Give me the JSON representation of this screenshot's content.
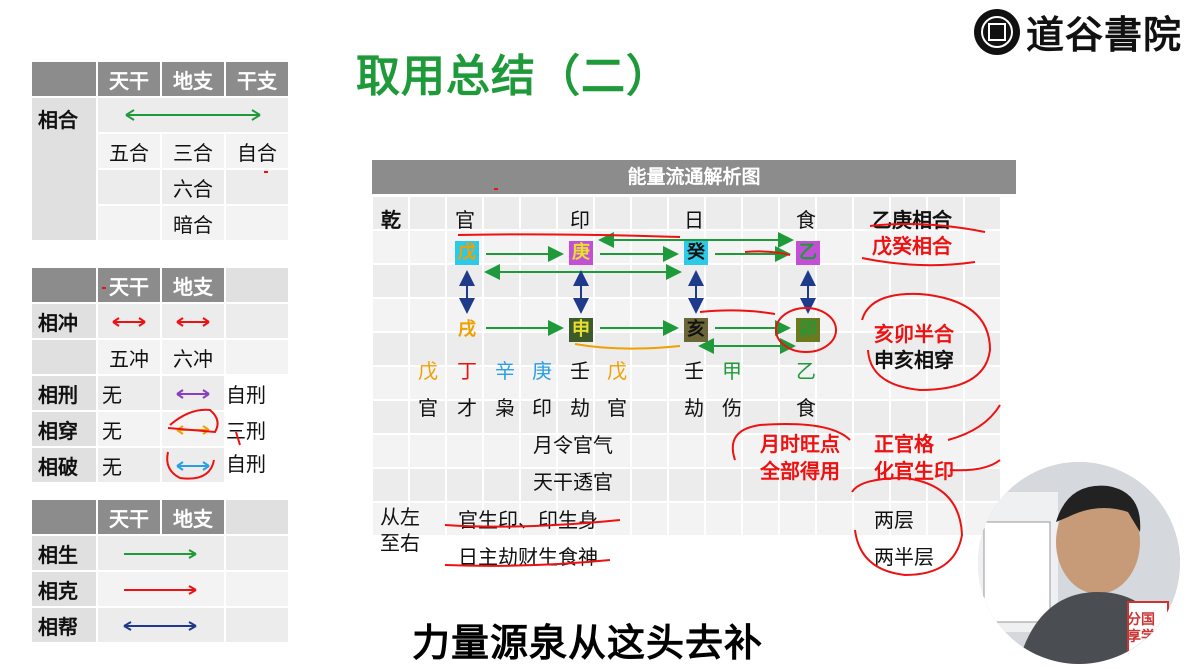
{
  "brand": {
    "logo_text": "道谷書院"
  },
  "title": "取用总结（二）",
  "table_he": {
    "headers": [
      "天干",
      "地支",
      "干支"
    ],
    "row_label": "相合",
    "rows": [
      [
        "五合",
        "三合",
        "自合"
      ],
      [
        "",
        "六合",
        ""
      ],
      [
        "",
        "暗合",
        ""
      ]
    ]
  },
  "table_chong": {
    "headers": [
      "天干",
      "地支"
    ],
    "rows": [
      {
        "label": "相冲",
        "tg": "",
        "dz": "",
        "extra": ""
      },
      {
        "label": "",
        "tg": "五冲",
        "dz": "六冲",
        "extra": ""
      },
      {
        "label": "相刑",
        "tg": "无",
        "dz": "",
        "extra": "自刑"
      },
      {
        "label": "相穿",
        "tg": "无",
        "dz": "",
        "extra": "三刑"
      },
      {
        "label": "相破",
        "tg": "无",
        "dz": "",
        "extra": "自刑"
      }
    ]
  },
  "table_sheng": {
    "headers": [
      "天干",
      "地支"
    ],
    "rows": [
      "相生",
      "相克",
      "相帮"
    ]
  },
  "chart": {
    "title": "能量流通解析图",
    "qian": "乾",
    "top_labels": [
      "官",
      "印",
      "日",
      "食"
    ],
    "stems": [
      "戊",
      "庚",
      "癸",
      "乙"
    ],
    "branches": [
      "戌",
      "申",
      "亥",
      "卯"
    ],
    "hidden": [
      "戊",
      "丁",
      "辛",
      "庚",
      "壬",
      "戊",
      "壬",
      "甲",
      "乙"
    ],
    "gods": [
      "官",
      "才",
      "枭",
      "印",
      "劫",
      "官",
      "劫",
      "伤",
      "食"
    ],
    "note_month": "月令官气",
    "note_tou": "天干透官",
    "left_note": "从左至右",
    "flow1": "官生印、印生身",
    "flow2": "日主劫财生食神",
    "right_he1": "乙庚相合",
    "right_he2": "戊癸相合",
    "right_b1": "亥卯半合",
    "right_b2": "申亥相穿",
    "right_w1": "月时旺点",
    "right_w2": "全部得用",
    "right_g1": "正官格",
    "right_g2": "化官生印",
    "layers1": "两层",
    "layers2": "两半层"
  },
  "colors": {
    "green": "#1f9a3a",
    "red": "#e11111",
    "purple": "#8a3fbf",
    "orange": "#f0a000",
    "blue": "#2aa0e0",
    "navy": "#1f3a8a"
  },
  "subtitle": "力量源泉从这头去补",
  "watermark": "分国享学"
}
